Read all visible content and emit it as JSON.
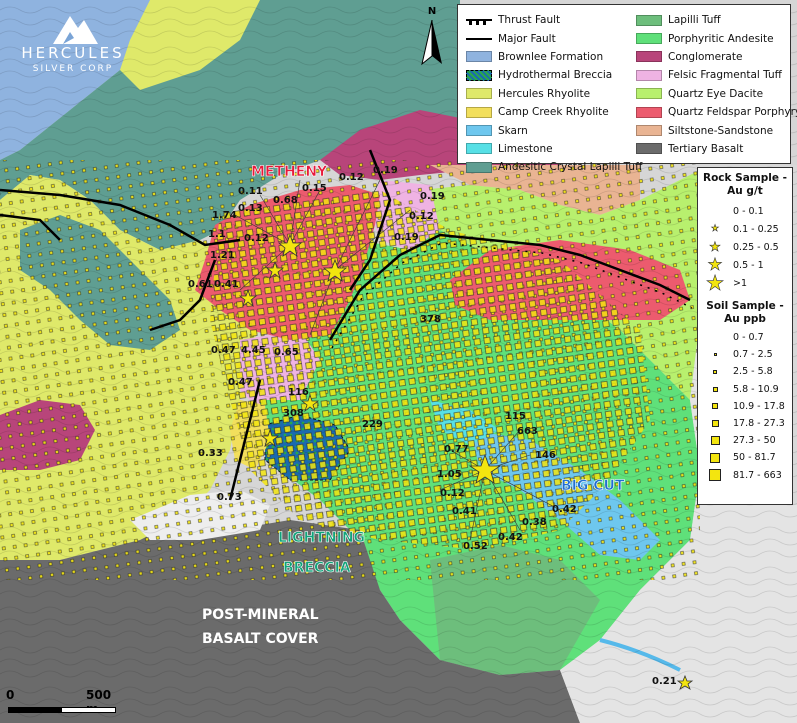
{
  "logo": {
    "title": "HERCULES",
    "subtitle": "SILVER CORP"
  },
  "north_arrow": {
    "label": "N"
  },
  "scale_bar": {
    "start": "0",
    "end": "500 m"
  },
  "map_labels": {
    "metheny": "METHENY",
    "lightning_breccia_1": "LIGHTNING",
    "lightning_breccia_2": "BRECCIA",
    "big_cut": "BIG CUT",
    "basalt_1": "POST-MINERAL",
    "basalt_2": "BASALT COVER"
  },
  "geology_legend": {
    "left": [
      {
        "label": "Thrust Fault",
        "kind": "thrust"
      },
      {
        "label": "Major Fault",
        "kind": "line"
      },
      {
        "label": "Brownlee Formation",
        "color": "#8fb3df"
      },
      {
        "label": "Hydrothermal Breccia",
        "kind": "breccia"
      },
      {
        "label": "Hercules Rhyolite",
        "color": "#dfe96a"
      },
      {
        "label": "Camp Creek Rhyolite",
        "color": "#f2df5c"
      },
      {
        "label": "Skarn",
        "color": "#6ec7ee"
      },
      {
        "label": "Limestone",
        "color": "#57e0e6"
      },
      {
        "label": "Andesitic Crystal Lapilli Tuff",
        "color": "#5f9e92"
      }
    ],
    "right": [
      {
        "label": "Lapilli Tuff",
        "color": "#6dbe7c"
      },
      {
        "label": "Porphyritic Andesite",
        "color": "#5fe07a"
      },
      {
        "label": "Conglomerate",
        "color": "#b8457a"
      },
      {
        "label": "Felsic Fragmental Tuff",
        "color": "#efb3e3"
      },
      {
        "label": "Quartz Eye Dacite",
        "color": "#b8f06e"
      },
      {
        "label": "Quartz Feldspar Porphyry",
        "color": "#ec5b6e"
      },
      {
        "label": "Siltstone-Sandstone",
        "color": "#e9b493"
      },
      {
        "label": "Tertiary Basalt",
        "color": "#6b6b6b"
      }
    ]
  },
  "rock_legend": {
    "title": "Rock Sample -",
    "subtitle": "Au g/t",
    "items": [
      {
        "label": "0 - 0.1",
        "size": 0
      },
      {
        "label": "0.1 - 0.25",
        "size": 9
      },
      {
        "label": "0.25 - 0.5",
        "size": 13
      },
      {
        "label": "0.5 - 1",
        "size": 17
      },
      {
        "label": ">1",
        "size": 21
      }
    ]
  },
  "soil_legend": {
    "title": "Soil Sample -",
    "subtitle": "Au ppb",
    "items": [
      {
        "label": "0 - 0.7",
        "size": 0
      },
      {
        "label": "0.7 - 2.5",
        "size": 3
      },
      {
        "label": "2.5 - 5.8",
        "size": 4
      },
      {
        "label": "5.8 - 10.9",
        "size": 5
      },
      {
        "label": "10.9 - 17.8",
        "size": 6
      },
      {
        "label": "17.8 - 27.3",
        "size": 7
      },
      {
        "label": "27.3 - 50",
        "size": 9
      },
      {
        "label": "50 - 81.7",
        "size": 10
      },
      {
        "label": "81.7 - 663",
        "size": 12
      }
    ]
  },
  "sample_values": [
    "0.19",
    "0.12",
    "0.15",
    "0.11",
    "0.68",
    "0.13",
    "1.74",
    "1.1",
    "0.12",
    "1.21",
    "0.61",
    "0.41",
    "0.19",
    "0.12",
    "0.19",
    "378",
    "0.47",
    "4.45",
    "0.65",
    "0.47",
    "116",
    "308",
    "229",
    "0.33",
    "0.73",
    "115",
    "663",
    "0.77",
    "146",
    "1.05",
    "0.12",
    "0.41",
    "0.38",
    "0.42",
    "0.42",
    "0.52",
    "0.21"
  ]
}
